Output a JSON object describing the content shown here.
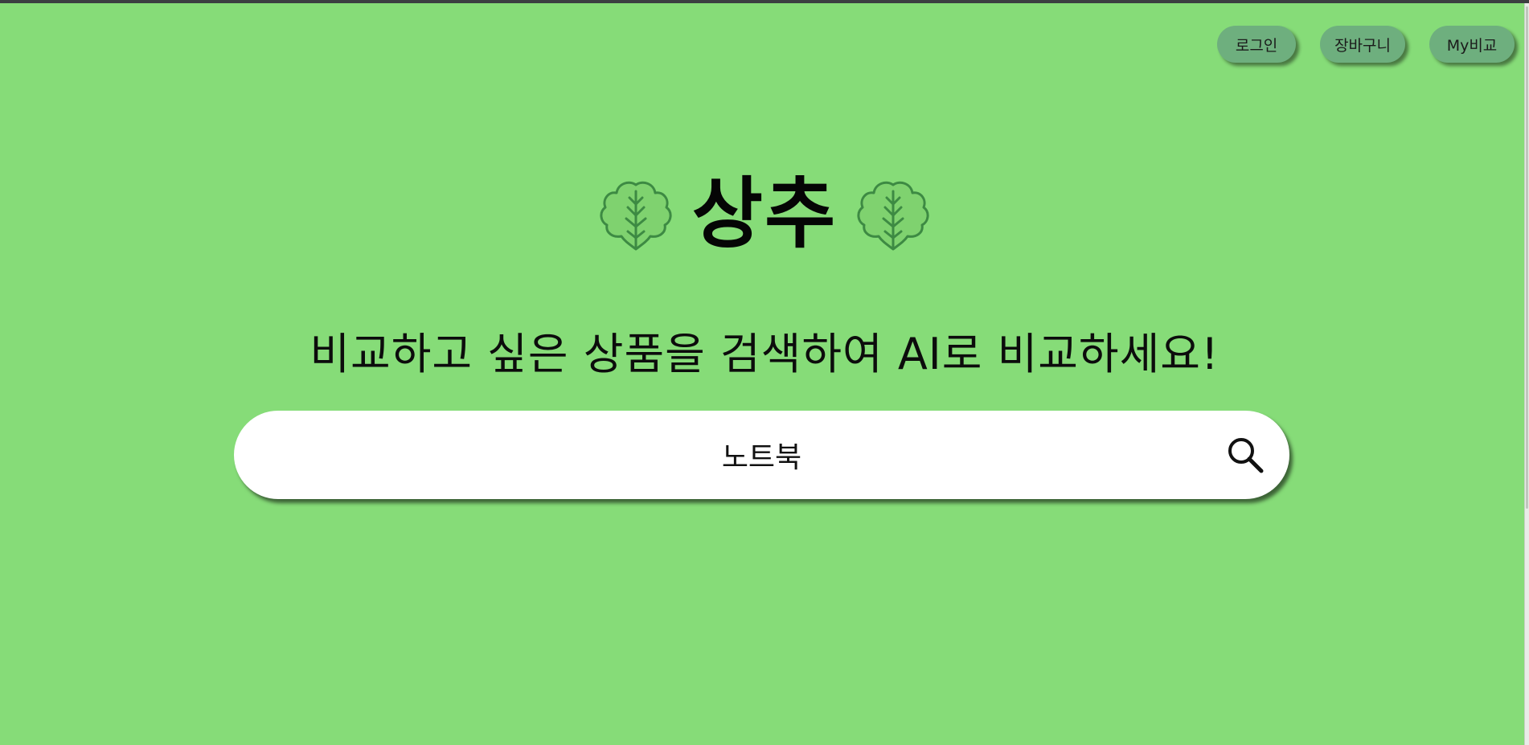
{
  "header": {
    "nav": [
      {
        "label": "로그인"
      },
      {
        "label": "장바구니"
      },
      {
        "label": "My비교"
      }
    ]
  },
  "hero": {
    "title": "상추",
    "left_icon": "lettuce-icon",
    "right_icon": "lettuce-icon",
    "subtitle": "비교하고 싶은 상품을 검색하여 AI로 비교하세요!"
  },
  "search": {
    "value": "노트북",
    "icon": "search-icon"
  },
  "colors": {
    "background": "#86dc78",
    "nav_button": "#6eaf7e",
    "leaf_stroke": "#3d8a43",
    "leaf_fill": "#7fd26f",
    "search_bg": "#ffffff"
  }
}
